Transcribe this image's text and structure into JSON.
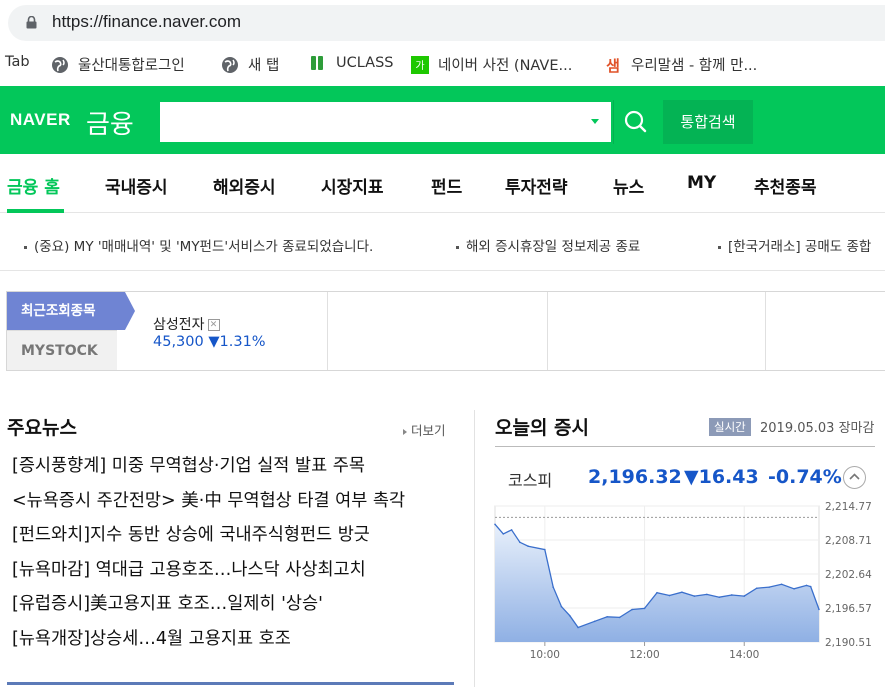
{
  "browser": {
    "url": "https://finance.naver.com",
    "bookmarks": [
      {
        "label": "Tab",
        "icon": "none"
      },
      {
        "label": "울산대통합로그인",
        "icon": "globe-icon"
      },
      {
        "label": "새 탭",
        "icon": "globe-icon"
      },
      {
        "label": "UCLASS",
        "icon": "uclass-icon"
      },
      {
        "label": "네이버 사전 (NAVE...",
        "icon": "naver-dict-icon"
      },
      {
        "label": "우리말샘 - 함께 만...",
        "icon": "urimal-icon"
      }
    ]
  },
  "header": {
    "logo": "NAVER",
    "section": "금융",
    "search_placeholder": "",
    "search_button": "통합검색",
    "brand_color": "#03c75a"
  },
  "nav": {
    "items": [
      "금융 홈",
      "국내증시",
      "해외증시",
      "시장지표",
      "펀드",
      "투자전략",
      "뉴스",
      "MY",
      "추천종목"
    ],
    "active": "금융 홈"
  },
  "notices": [
    "(중요) MY '매매내역' 및 'MY펀드'서비스가 종료되었습니다.",
    "해외 증시휴장일 정보제공 종료",
    "[한국거래소] 공매도 종합"
  ],
  "recent": {
    "tab_recent": "최근조회종목",
    "tab_mystock": "MYSTOCK",
    "stocks": [
      {
        "name": "삼성전자",
        "price": "45,300",
        "change": "▼1.31%"
      }
    ]
  },
  "news": {
    "title": "주요뉴스",
    "more": "더보기",
    "items": [
      "[증시풍향계] 미중 무역협상·기업 실적 발표 주목",
      "<뉴욕증시 주간전망> 美·中 무역협상 타결 여부 촉각",
      "[펀드와치]지수 동반 상승에 국내주식형펀드 방긋",
      "[뉴욕마감] 역대급 고용호조…나스닥 사상최고치",
      "[유럽증시]美고용지표 호조…일제히 '상승'",
      "[뉴욕개장]상승세…4월 고용지표 호조"
    ]
  },
  "market": {
    "title": "오늘의 증시",
    "badge": "실시간",
    "date": "2019.05.03",
    "status": "장마감",
    "index_name": "코스피",
    "index_value": "2,196.32",
    "index_change": "▼16.43",
    "index_pct": "-0.74%",
    "down_color": "#1656c8"
  },
  "chart_data": {
    "type": "area",
    "title": "",
    "xlabel": "",
    "ylabel": "",
    "x_ticks": [
      "10:00",
      "12:00",
      "14:00"
    ],
    "y_ticks": [
      2214.77,
      2208.71,
      2202.64,
      2196.57,
      2190.51
    ],
    "ylim": [
      2190.51,
      2214.77
    ],
    "xlim": [
      "09:00",
      "15:30"
    ],
    "reference_line": 2212.75,
    "grid": true,
    "series": [
      {
        "x": [
          "09:00",
          "09:10",
          "09:20",
          "09:30",
          "09:40",
          "10:00",
          "10:10",
          "10:20",
          "10:30",
          "10:40",
          "11:00",
          "11:15",
          "11:30",
          "11:45",
          "12:00",
          "12:15",
          "12:30",
          "12:45",
          "13:00",
          "13:15",
          "13:30",
          "13:45",
          "14:00",
          "14:15",
          "14:30",
          "14:45",
          "15:00",
          "15:15",
          "15:20",
          "15:30"
        ],
        "y": [
          2211.5,
          2209.8,
          2210.5,
          2208.3,
          2207.6,
          2207.0,
          2200.3,
          2196.8,
          2195.2,
          2193.1,
          2194.2,
          2195.0,
          2194.9,
          2196.3,
          2196.5,
          2199.3,
          2198.8,
          2199.4,
          2198.7,
          2199.0,
          2198.5,
          2198.9,
          2198.7,
          2200.1,
          2200.3,
          2200.8,
          2200.0,
          2200.6,
          2200.4,
          2196.32
        ]
      }
    ]
  }
}
